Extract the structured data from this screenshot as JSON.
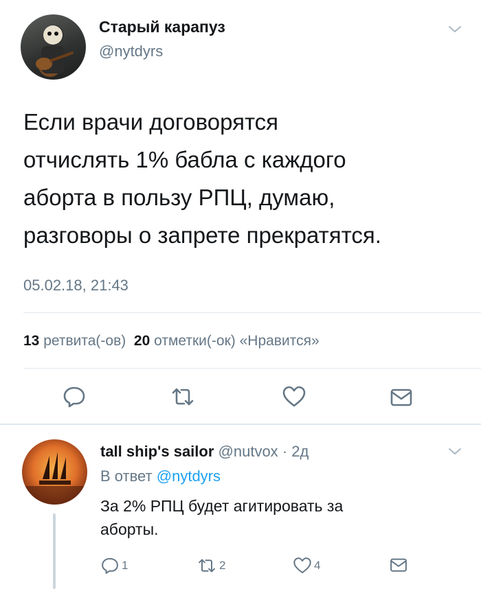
{
  "tweet": {
    "author_name": "Старый карапуз",
    "author_handle": "@nytdyrs",
    "avatar_icon": "avatar-guitar-player",
    "text_lines": [
      "Если врачи договорятся",
      "отчислять 1% бабла с каждого",
      "аборта в пользу РПЦ, думаю,",
      "разговоры о запрете прекратятся."
    ],
    "timestamp": "05.02.18, 21:43",
    "retweets_count": "13",
    "retweets_label": "ретвита(-ов)",
    "likes_count": "20",
    "likes_label": "отметки(-ок) «Нравится»",
    "actions": [
      "reply-icon",
      "retweet-icon",
      "like-icon",
      "dm-icon"
    ]
  },
  "reply": {
    "author_name": "tall ship's sailor",
    "author_handle": "@nutvox",
    "time": "· 2д",
    "avatar_icon": "avatar-sailing-ship-sunset",
    "in_reply_prefix": "В ответ",
    "in_reply_handle": "@nytdyrs",
    "text_lines": [
      "За 2% РПЦ будет агитировать за",
      "аборты."
    ],
    "reply_count": "1",
    "retweet_count": "2",
    "like_count": "4"
  },
  "colors": {
    "primary_text": "#14171a",
    "secondary_text": "#657786",
    "link": "#1da1f2",
    "divider": "#e1e8ed"
  }
}
